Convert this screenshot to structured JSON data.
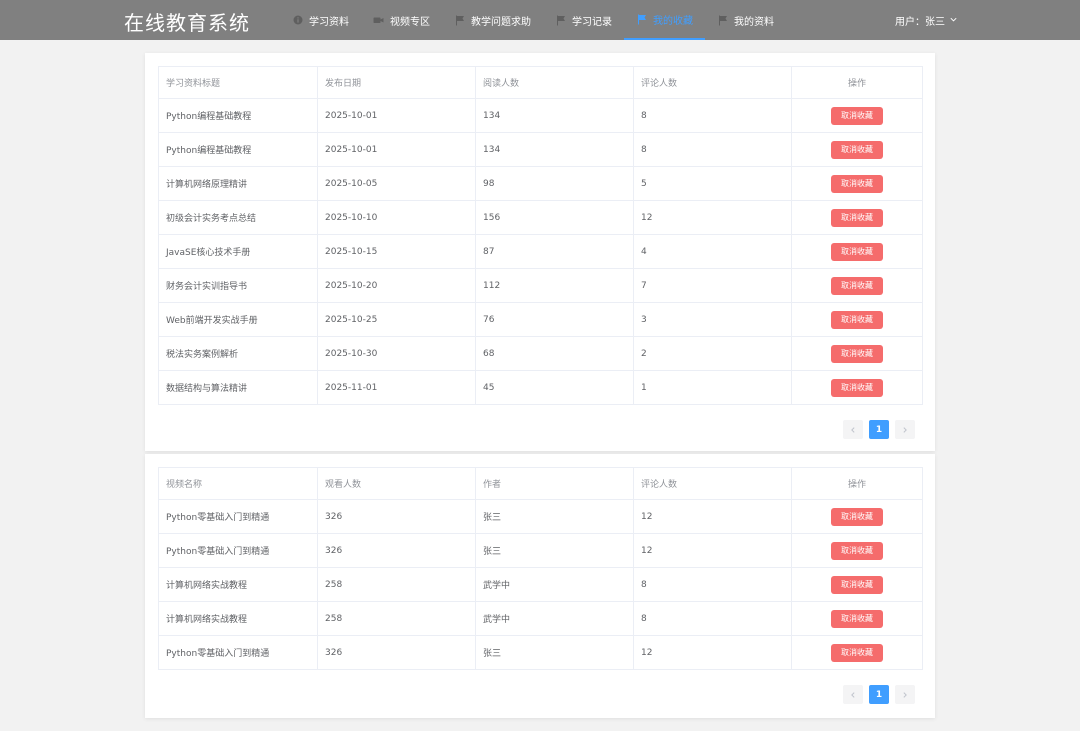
{
  "header": {
    "brand": "在线教育系统",
    "nav": [
      {
        "label": "学习资料",
        "icon": "info-circle-icon",
        "active": false
      },
      {
        "label": "视频专区",
        "icon": "video-camera-icon",
        "active": false
      },
      {
        "label": "教学问题求助",
        "icon": "flag-icon",
        "active": false
      },
      {
        "label": "学习记录",
        "icon": "flag-icon",
        "active": false
      },
      {
        "label": "我的收藏",
        "icon": "flag-icon",
        "active": true
      },
      {
        "label": "我的资料",
        "icon": "flag-icon",
        "active": false
      }
    ],
    "user_label": "用户：张三"
  },
  "materials": {
    "columns": [
      "学习资料标题",
      "发布日期",
      "阅读人数",
      "评论人数",
      "操作"
    ],
    "rows": [
      [
        "Python编程基础教程",
        "2025-10-01",
        "134",
        "8"
      ],
      [
        "Python编程基础教程",
        "2025-10-01",
        "134",
        "8"
      ],
      [
        "计算机网络原理精讲",
        "2025-10-05",
        "98",
        "5"
      ],
      [
        "初级会计实务考点总结",
        "2025-10-10",
        "156",
        "12"
      ],
      [
        "JavaSE核心技术手册",
        "2025-10-15",
        "87",
        "4"
      ],
      [
        "财务会计实训指导书",
        "2025-10-20",
        "112",
        "7"
      ],
      [
        "Web前端开发实战手册",
        "2025-10-25",
        "76",
        "3"
      ],
      [
        "税法实务案例解析",
        "2025-10-30",
        "68",
        "2"
      ],
      [
        "数据结构与算法精讲",
        "2025-11-01",
        "45",
        "1"
      ]
    ],
    "action_label": "取消收藏",
    "page": "1"
  },
  "videos": {
    "columns": [
      "视频名称",
      "观看人数",
      "作者",
      "评论人数",
      "操作"
    ],
    "rows": [
      [
        "Python零基础入门到精通",
        "326",
        "张三",
        "12"
      ],
      [
        "Python零基础入门到精通",
        "326",
        "张三",
        "12"
      ],
      [
        "计算机网络实战教程",
        "258",
        "武学中",
        "8"
      ],
      [
        "计算机网络实战教程",
        "258",
        "武学中",
        "8"
      ],
      [
        "Python零基础入门到精通",
        "326",
        "张三",
        "12"
      ]
    ],
    "action_label": "取消收藏",
    "page": "1"
  },
  "colors": {
    "topbar": "#808080",
    "accent": "#409eff",
    "danger": "#f56c6c"
  }
}
